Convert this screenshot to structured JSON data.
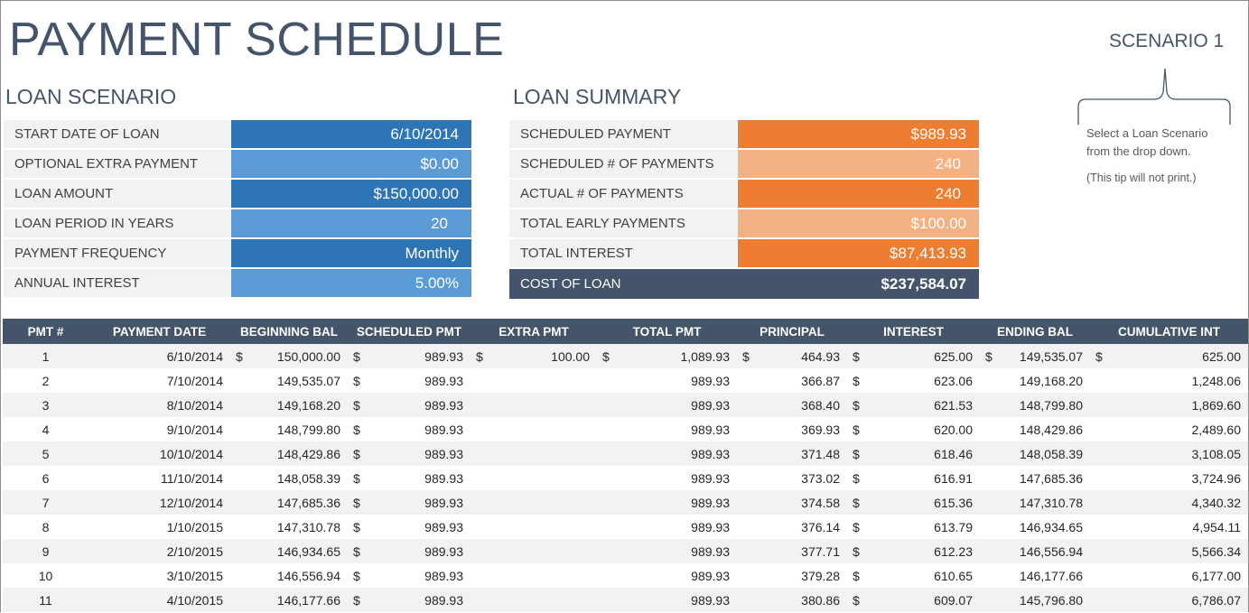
{
  "title": "PAYMENT SCHEDULE",
  "scenario": {
    "label": "SCENARIO 1",
    "tip_line1": "Select a Loan Scenario",
    "tip_line2": "from the drop down.",
    "tip_note": "(This tip will not print.)"
  },
  "loan_scenario": {
    "heading": "LOAN SCENARIO",
    "rows": [
      {
        "label": "START DATE OF LOAN",
        "value": "6/10/2014"
      },
      {
        "label": "OPTIONAL EXTRA PAYMENT",
        "value": "$0.00"
      },
      {
        "label": "LOAN AMOUNT",
        "value": "$150,000.00"
      },
      {
        "label": "LOAN PERIOD IN YEARS",
        "value": "20"
      },
      {
        "label": "PAYMENT FREQUENCY",
        "value": "Monthly"
      },
      {
        "label": "ANNUAL INTEREST",
        "value": "5.00%"
      }
    ]
  },
  "loan_summary": {
    "heading": "LOAN SUMMARY",
    "rows": [
      {
        "label": "SCHEDULED PAYMENT",
        "value": "$989.93"
      },
      {
        "label": "SCHEDULED # OF PAYMENTS",
        "value": "240"
      },
      {
        "label": "ACTUAL # OF PAYMENTS",
        "value": "240"
      },
      {
        "label": "TOTAL EARLY PAYMENTS",
        "value": "$100.00"
      },
      {
        "label": "TOTAL INTEREST",
        "value": "$87,413.93"
      },
      {
        "label": "COST OF LOAN",
        "value": "$237,584.07"
      }
    ]
  },
  "schedule": {
    "columns": [
      "PMT #",
      "PAYMENT DATE",
      "BEGINNING BAL",
      "SCHEDULED PMT",
      "EXTRA PMT",
      "TOTAL PMT",
      "PRINCIPAL",
      "INTEREST",
      "ENDING BAL",
      "CUMULATIVE INT"
    ],
    "currency_symbol": "$",
    "rows": [
      {
        "pmt": "1",
        "date": "6/10/2014",
        "beg": "150,000.00",
        "sched": "989.93",
        "extra": "100.00",
        "total": "1,089.93",
        "principal": "464.93",
        "interest": "625.00",
        "end": "149,535.07",
        "cum": "625.00",
        "show_currency": true
      },
      {
        "pmt": "2",
        "date": "7/10/2014",
        "beg": "149,535.07",
        "sched": "989.93",
        "extra": "",
        "total": "989.93",
        "principal": "366.87",
        "interest": "623.06",
        "end": "149,168.20",
        "cum": "1,248.06",
        "show_currency": false
      },
      {
        "pmt": "3",
        "date": "8/10/2014",
        "beg": "149,168.20",
        "sched": "989.93",
        "extra": "",
        "total": "989.93",
        "principal": "368.40",
        "interest": "621.53",
        "end": "148,799.80",
        "cum": "1,869.60",
        "show_currency": false
      },
      {
        "pmt": "4",
        "date": "9/10/2014",
        "beg": "148,799.80",
        "sched": "989.93",
        "extra": "",
        "total": "989.93",
        "principal": "369.93",
        "interest": "620.00",
        "end": "148,429.86",
        "cum": "2,489.60",
        "show_currency": false
      },
      {
        "pmt": "5",
        "date": "10/10/2014",
        "beg": "148,429.86",
        "sched": "989.93",
        "extra": "",
        "total": "989.93",
        "principal": "371.48",
        "interest": "618.46",
        "end": "148,058.39",
        "cum": "3,108.05",
        "show_currency": false
      },
      {
        "pmt": "6",
        "date": "11/10/2014",
        "beg": "148,058.39",
        "sched": "989.93",
        "extra": "",
        "total": "989.93",
        "principal": "373.02",
        "interest": "616.91",
        "end": "147,685.36",
        "cum": "3,724.96",
        "show_currency": false
      },
      {
        "pmt": "7",
        "date": "12/10/2014",
        "beg": "147,685.36",
        "sched": "989.93",
        "extra": "",
        "total": "989.93",
        "principal": "374.58",
        "interest": "615.36",
        "end": "147,310.78",
        "cum": "4,340.32",
        "show_currency": false
      },
      {
        "pmt": "8",
        "date": "1/10/2015",
        "beg": "147,310.78",
        "sched": "989.93",
        "extra": "",
        "total": "989.93",
        "principal": "376.14",
        "interest": "613.79",
        "end": "146,934.65",
        "cum": "4,954.11",
        "show_currency": false
      },
      {
        "pmt": "9",
        "date": "2/10/2015",
        "beg": "146,934.65",
        "sched": "989.93",
        "extra": "",
        "total": "989.93",
        "principal": "377.71",
        "interest": "612.23",
        "end": "146,556.94",
        "cum": "5,566.34",
        "show_currency": false
      },
      {
        "pmt": "10",
        "date": "3/10/2015",
        "beg": "146,556.94",
        "sched": "989.93",
        "extra": "",
        "total": "989.93",
        "principal": "379.28",
        "interest": "610.65",
        "end": "146,177.66",
        "cum": "6,177.00",
        "show_currency": false
      },
      {
        "pmt": "11",
        "date": "4/10/2015",
        "beg": "146,177.66",
        "sched": "989.93",
        "extra": "",
        "total": "989.93",
        "principal": "380.86",
        "interest": "609.07",
        "end": "145,796.80",
        "cum": "6,786.07",
        "show_currency": false
      }
    ]
  },
  "colors": {
    "heading": "#44546a",
    "scenario_dark": "#2e75b6",
    "scenario_light": "#5b9bd5",
    "summary_dark": "#ed7d31",
    "summary_light": "#f4b183",
    "header_bar": "#44546a",
    "band": "#f2f2f2"
  }
}
